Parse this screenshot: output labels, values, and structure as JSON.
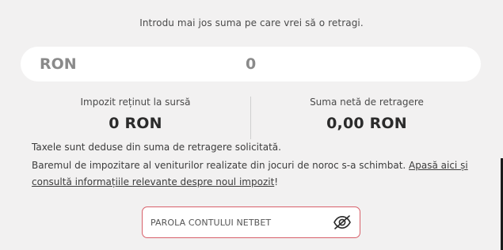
{
  "intro_text": "Introdu mai jos suma pe care vrei să o retragi.",
  "amount": {
    "currency": "RON",
    "value": "0"
  },
  "tax": {
    "label": "Impozit reținut la sursă",
    "value": "0 RON"
  },
  "net": {
    "label": "Suma netă de retragere",
    "value": "0,00 RON"
  },
  "notes": {
    "line1": "Taxele sunt deduse din suma de retragere solicitată.",
    "line2_prefix": "Baremul de impozitare al veniturilor realizate din jocuri de noroc s-a schimbat. ",
    "link_text": "Apasă aici și consultă informațiile relevante despre noul impozit",
    "line2_suffix": "!"
  },
  "password": {
    "placeholder": "PAROLA CONTULUI NETBET",
    "toggle_icon": "eye-slash-icon"
  },
  "colors": {
    "background": "#f2f1f1",
    "password_border": "#d8606a"
  }
}
